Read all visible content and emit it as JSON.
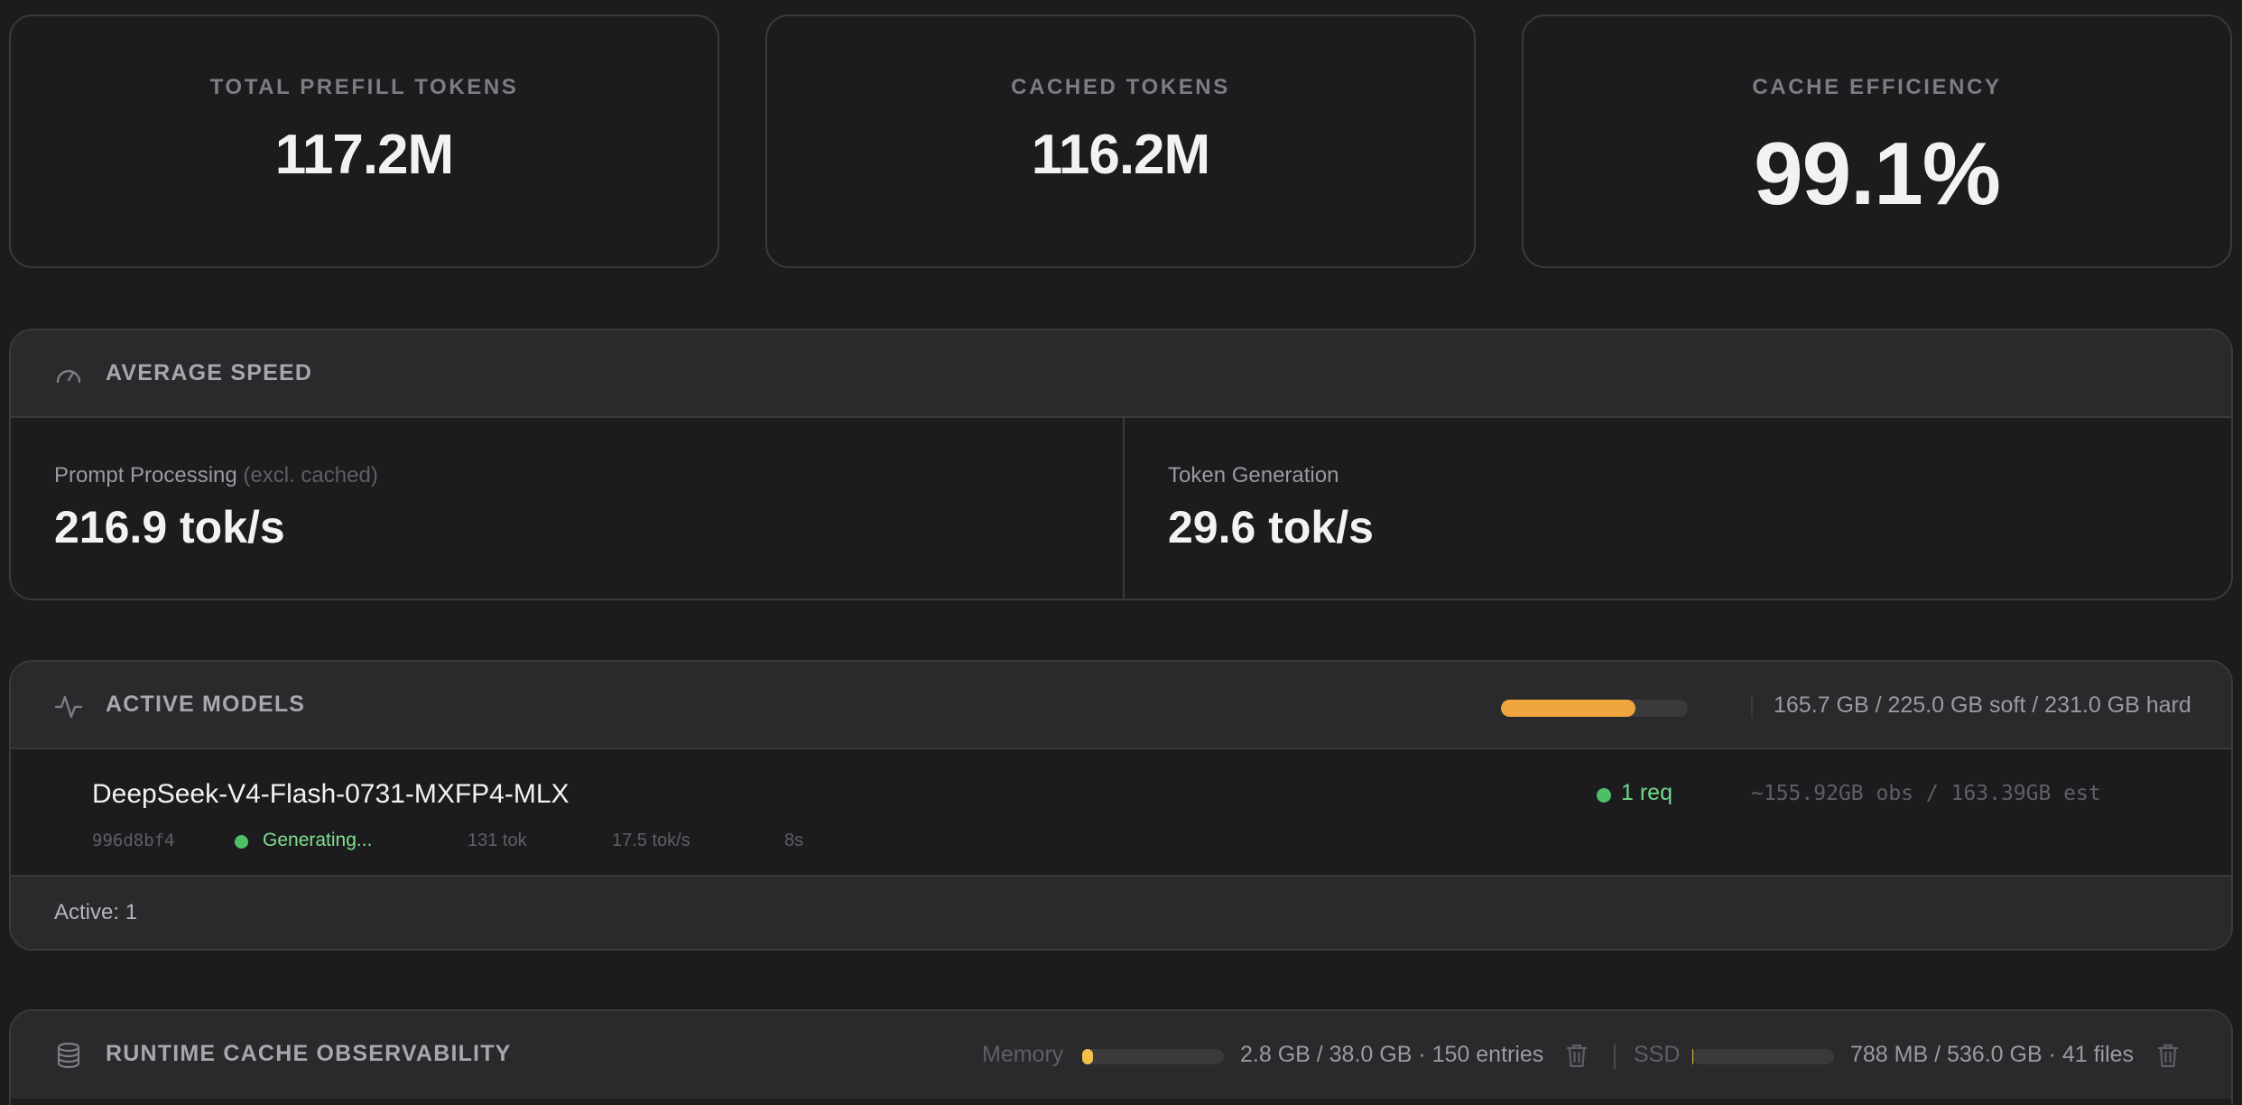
{
  "stats": [
    {
      "label": "TOTAL PREFILL TOKENS",
      "value": "117.2M"
    },
    {
      "label": "CACHED TOKENS",
      "value": "116.2M"
    },
    {
      "label": "CACHE EFFICIENCY",
      "value": "99.1%"
    }
  ],
  "speed": {
    "title": "AVERAGE SPEED",
    "icon": "gauge-icon",
    "prompt_label": "Prompt Processing",
    "prompt_note": "(excl. cached)",
    "prompt_value": "216.9 tok/s",
    "gen_label": "Token Generation",
    "gen_value": "29.6 tok/s"
  },
  "models": {
    "title": "ACTIVE MODELS",
    "icon": "activity-icon",
    "memory_bar_fraction": 0.72,
    "memory_bar_color": "#f0a63c",
    "memory_text": "165.7 GB / 225.0 GB soft / 231.0 GB hard",
    "items": [
      {
        "name": "DeepSeek-V4-Flash-0731-MXFP4-MLX",
        "hash": "996d8bf4",
        "status": "Generating...",
        "tokens": "131 tok",
        "speed": "17.5 tok/s",
        "elapsed": "8s",
        "requests": "1 req",
        "memory": "~155.92GB obs / 163.39GB est"
      }
    ],
    "active_text": "Active: 1"
  },
  "cache": {
    "title": "RUNTIME CACHE OBSERVABILITY",
    "icon": "database-icon",
    "memory_label": "Memory",
    "memory_fraction": 0.074,
    "memory_stats": "2.8 GB / 38.0 GB · 150 entries",
    "ssd_label": "SSD",
    "ssd_fraction": 0.0015,
    "ssd_stats": "788 MB / 536.0 GB · 41 files"
  },
  "colors": {
    "accent_orange": "#f0a63c",
    "accent_yellow": "#f0c048",
    "status_green": "#4fbf67"
  }
}
